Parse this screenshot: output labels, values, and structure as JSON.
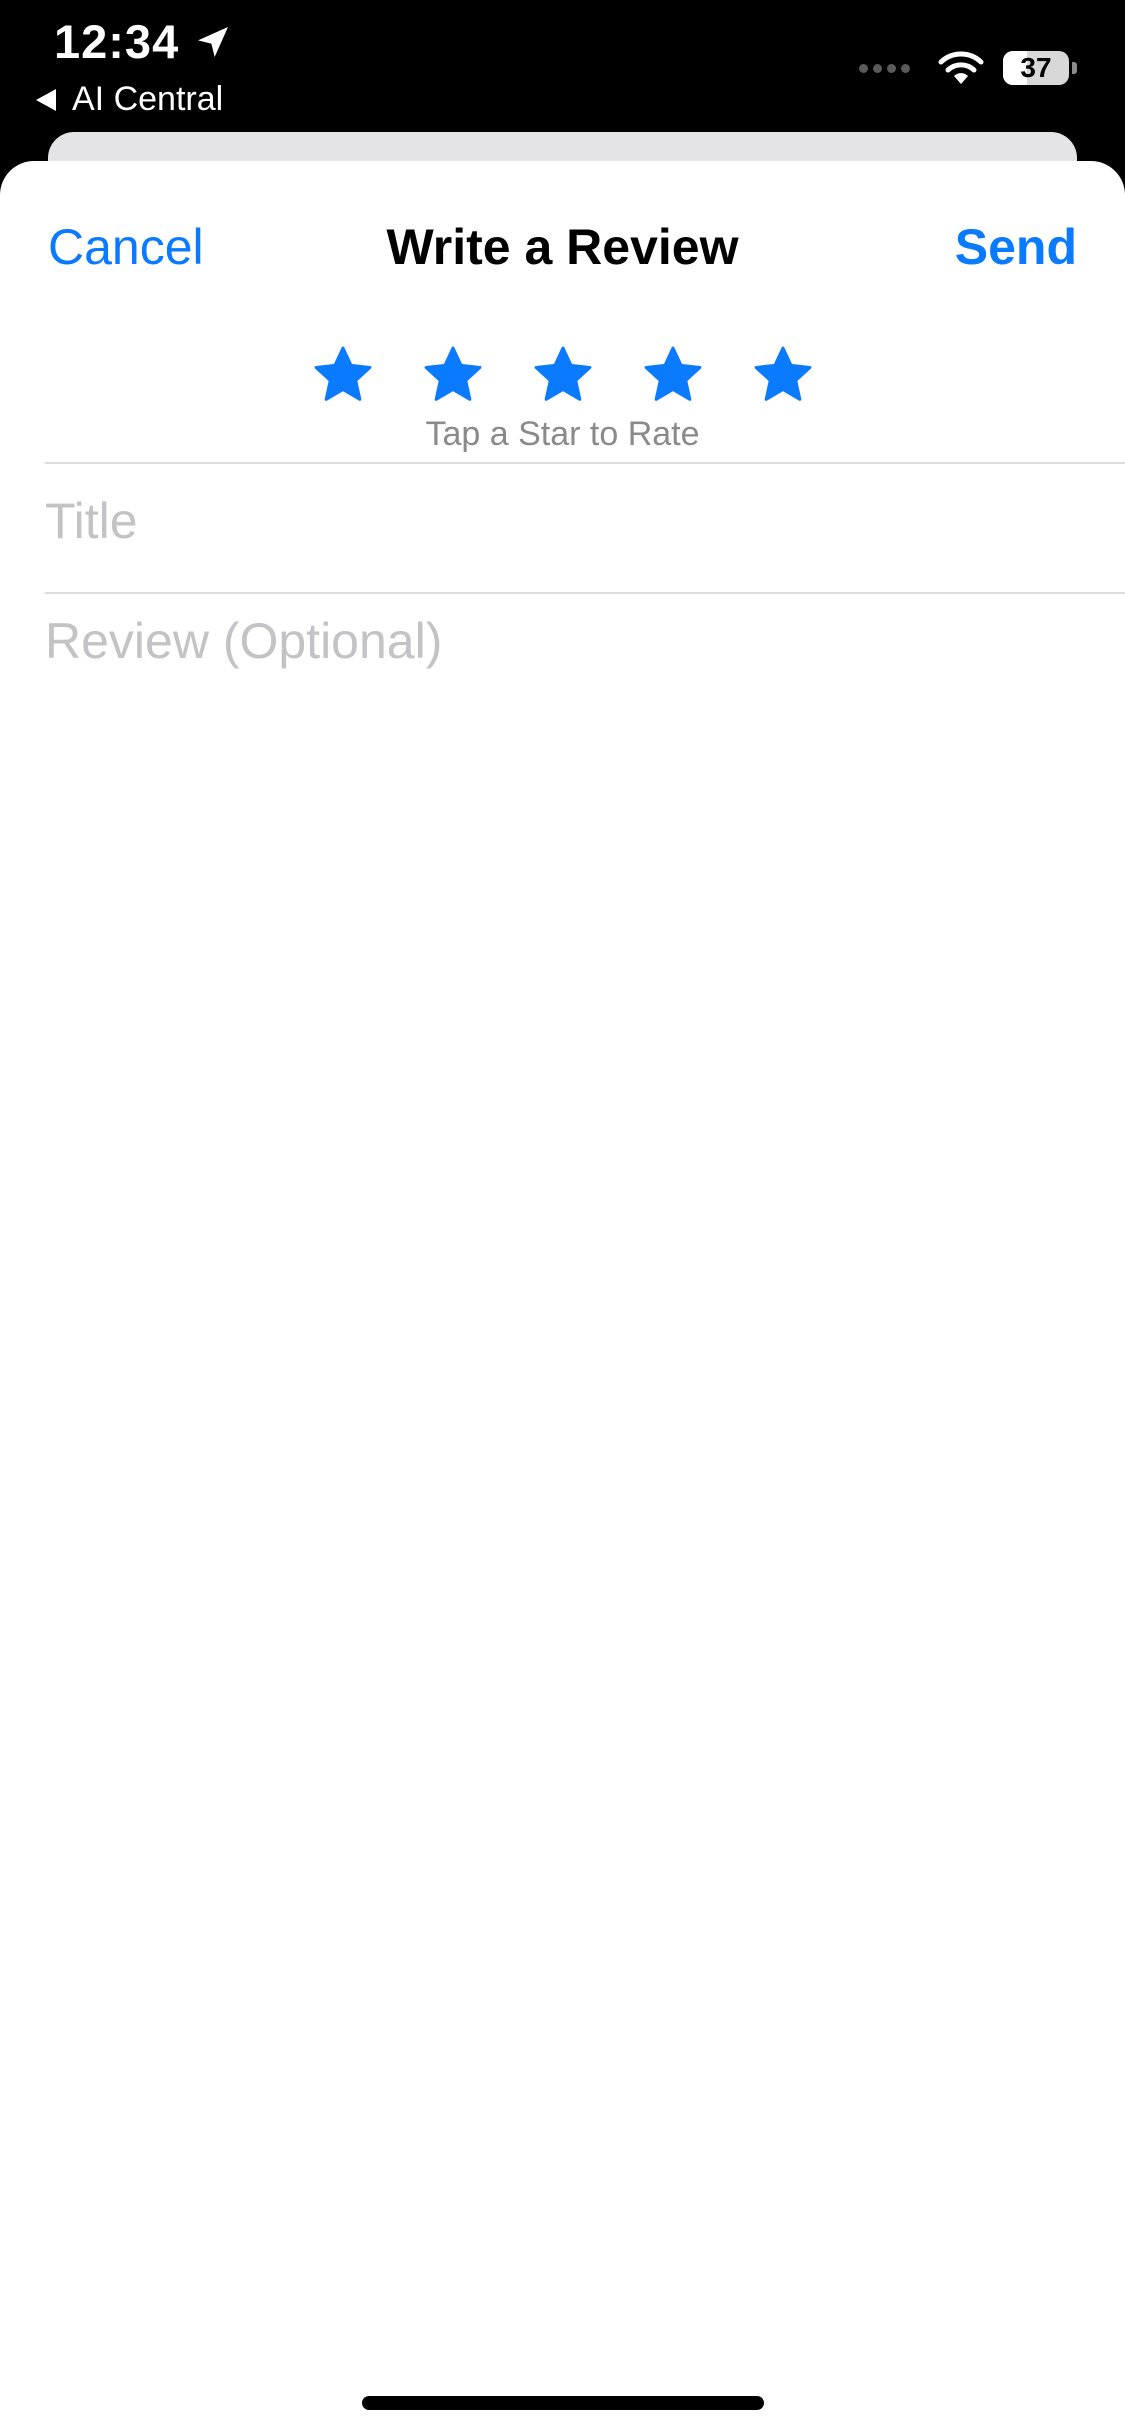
{
  "status_bar": {
    "time": "12:34",
    "back_app_label": "AI Central",
    "battery_percent": "37",
    "battery_level": 0.37,
    "icons": [
      "location-arrow-icon",
      "signal-icon",
      "wifi-icon",
      "battery-icon"
    ]
  },
  "nav": {
    "cancel_label": "Cancel",
    "title": "Write a Review",
    "send_label": "Send"
  },
  "rating": {
    "star_count": 5,
    "hint": "Tap a Star to Rate"
  },
  "form": {
    "title_placeholder": "Title",
    "title_value": "",
    "review_placeholder": "Review (Optional)",
    "review_value": ""
  },
  "colors": {
    "accent": "#0a7aff",
    "placeholder": "#c3c3c7",
    "hint": "#8a8a8e",
    "status_bar_bg": "#000000"
  }
}
